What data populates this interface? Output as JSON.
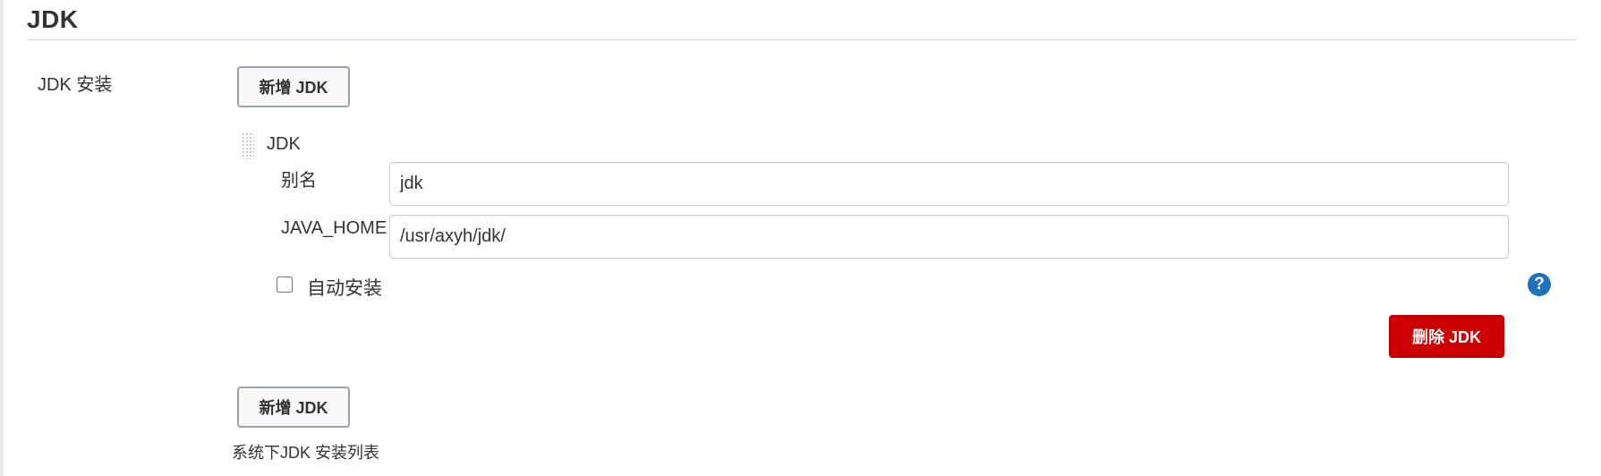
{
  "section": {
    "title": "JDK"
  },
  "setting": {
    "label": "JDK 安装",
    "add_button_label": "新增 JDK",
    "description": "系统下JDK 安装列表"
  },
  "installation": {
    "header": "JDK",
    "alias_label": "别名",
    "alias_value": "jdk",
    "java_home_label": "JAVA_HOME",
    "java_home_value": "/usr/axyh/jdk/",
    "auto_install_label": "自动安装",
    "auto_install_checked": false,
    "help_symbol": "?",
    "delete_button_label": "删除 JDK"
  },
  "colors": {
    "delete_button": "#cc0000",
    "help_icon": "#2173b9"
  }
}
